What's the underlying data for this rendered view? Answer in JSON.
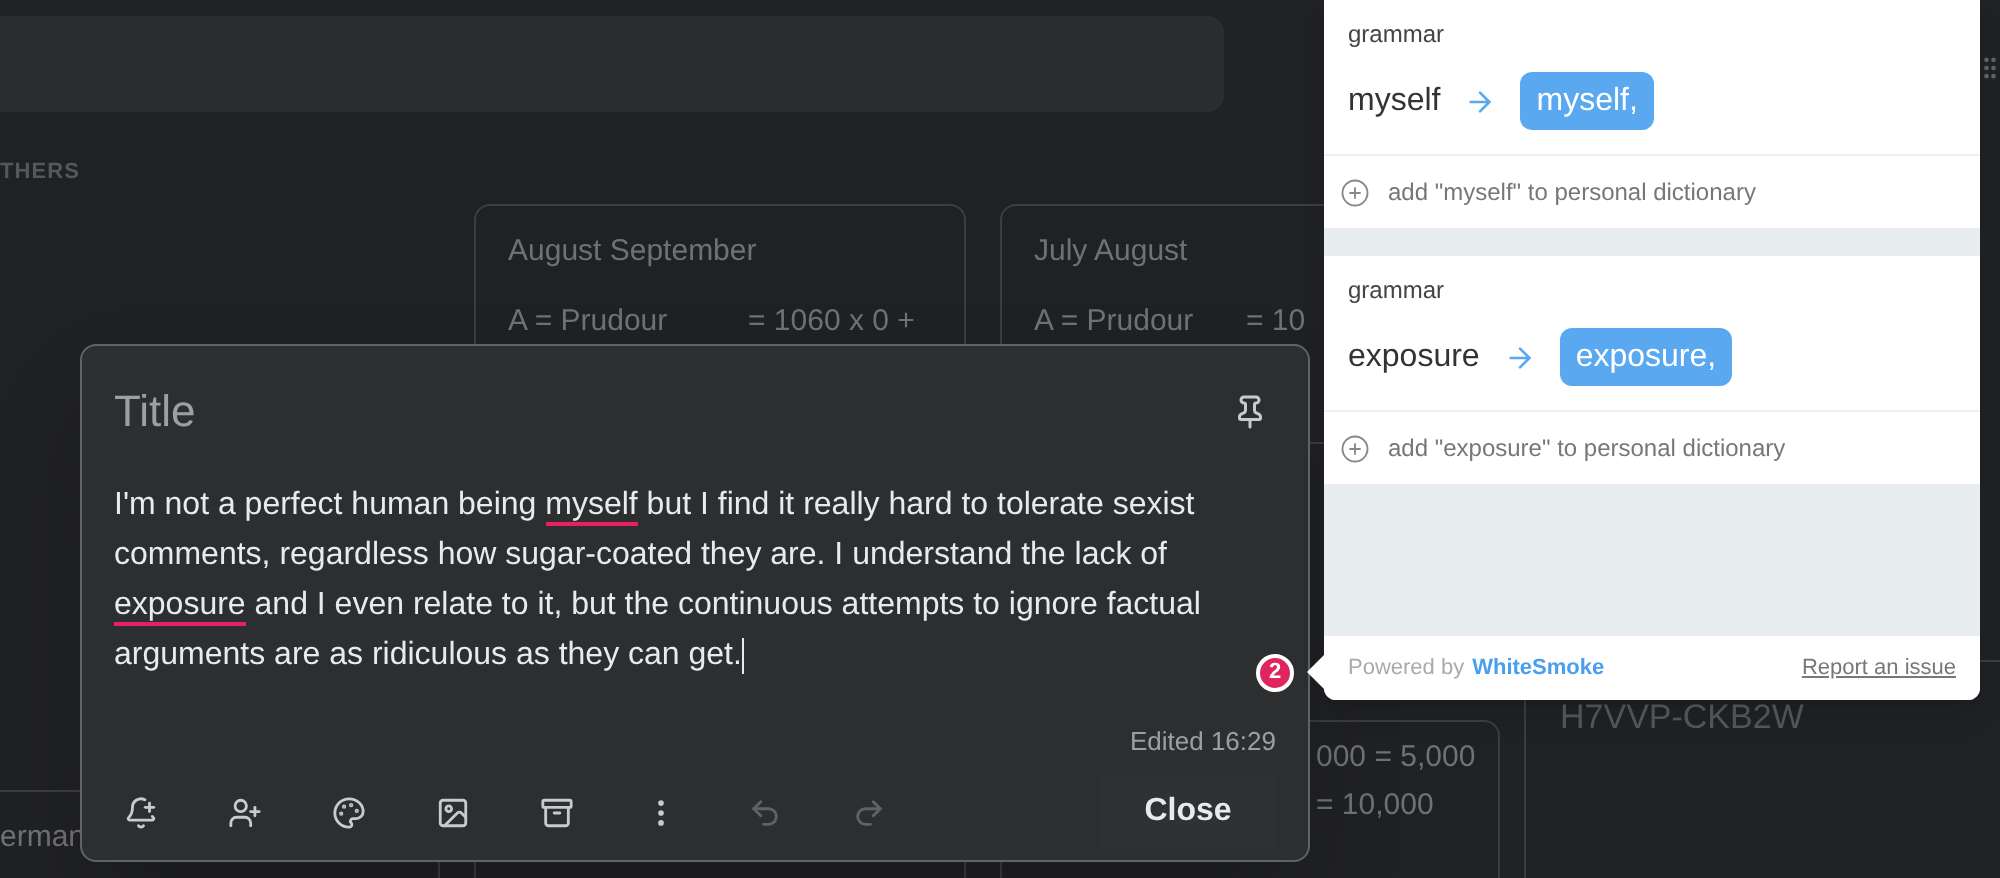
{
  "background": {
    "section_label": "THERS",
    "cards": [
      {
        "title": "August September",
        "lines": [
          {
            "label": "A = Prudour",
            "value": "= 1060 x 0 +"
          }
        ]
      },
      {
        "title": "July August",
        "lines": [
          {
            "label": "A = Prudour",
            "value": "= 10"
          }
        ]
      }
    ],
    "bottom_texts": [
      {
        "kind": "code",
        "text": "H7VVP-CKB2W"
      },
      {
        "kind": "right",
        "text": "000 = 5,000"
      },
      {
        "kind": "right",
        "text": "= 10,000"
      },
      {
        "kind": "left",
        "text": "erman"
      }
    ]
  },
  "note": {
    "title_placeholder": "Title",
    "body": [
      {
        "text": "I'm not a perfect human being ",
        "flagged": false
      },
      {
        "text": "myself",
        "flagged": true
      },
      {
        "text": " but I find it really hard to tolerate sexist comments, regardless how sugar-coated they are. I understand the lack of ",
        "flagged": false
      },
      {
        "text": "exposure",
        "flagged": true
      },
      {
        "text": " and I even relate to it, but the continuous attempts to ignore factual arguments are as ridiculous as they can get.",
        "flagged": false
      }
    ],
    "edited": "Edited 16:29",
    "tools": [
      {
        "kind": "reminder",
        "disabled": false
      },
      {
        "kind": "collaborator",
        "disabled": false
      },
      {
        "kind": "palette",
        "disabled": false
      },
      {
        "kind": "image",
        "disabled": false
      },
      {
        "kind": "archive",
        "disabled": false
      },
      {
        "kind": "more",
        "disabled": false
      },
      {
        "kind": "undo",
        "disabled": true
      },
      {
        "kind": "redo",
        "disabled": true
      }
    ],
    "close": "Close",
    "badge": "2"
  },
  "popup": {
    "suggestions": [
      {
        "category": "grammar",
        "word": "myself",
        "replacement": "myself,",
        "add": "add \"myself\" to personal dictionary"
      },
      {
        "category": "grammar",
        "word": "exposure",
        "replacement": "exposure,",
        "add": "add \"exposure\" to personal dictionary"
      }
    ],
    "powered_by": "Powered by",
    "brand": "WhiteSmoke",
    "report": "Report an issue"
  }
}
